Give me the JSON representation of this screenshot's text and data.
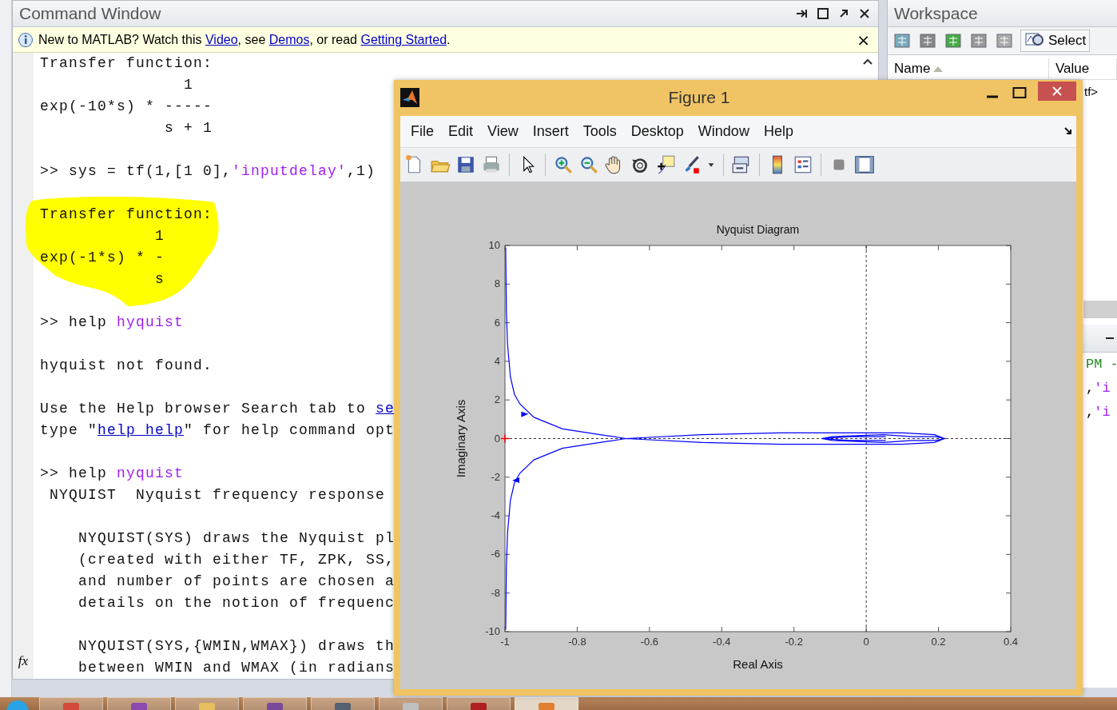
{
  "command_window": {
    "title": "Command Window",
    "banner": {
      "segments": [
        {
          "kind": "plain",
          "text": "New to MATLAB? Watch this "
        },
        {
          "kind": "link",
          "text": "Video"
        },
        {
          "kind": "plain",
          "text": ", see "
        },
        {
          "kind": "link",
          "text": "Demos"
        },
        {
          "kind": "plain",
          "text": ", or read "
        },
        {
          "kind": "link",
          "text": "Getting Started"
        },
        {
          "kind": "plain",
          "text": "."
        }
      ],
      "close": "×"
    },
    "lines": [
      {
        "kind": "text",
        "highlighted": false,
        "segments": [
          {
            "kind": "plain",
            "text": "Transfer function:"
          }
        ]
      },
      {
        "kind": "text",
        "highlighted": false,
        "segments": [
          {
            "kind": "plain",
            "text": "               1"
          }
        ]
      },
      {
        "kind": "text",
        "highlighted": false,
        "segments": [
          {
            "kind": "plain",
            "text": "exp(-10*s) * -----"
          }
        ]
      },
      {
        "kind": "text",
        "highlighted": false,
        "segments": [
          {
            "kind": "plain",
            "text": "             s + 1"
          }
        ]
      },
      {
        "kind": "blank"
      },
      {
        "kind": "text",
        "highlighted": false,
        "segments": [
          {
            "kind": "plain",
            "text": ">> sys = tf(1,[1 0],"
          },
          {
            "kind": "string",
            "text": "'inputdelay'"
          },
          {
            "kind": "plain",
            "text": ",1)"
          }
        ]
      },
      {
        "kind": "blank"
      },
      {
        "kind": "text",
        "highlighted": true,
        "segments": [
          {
            "kind": "plain",
            "text": "Transfer function:"
          }
        ]
      },
      {
        "kind": "text",
        "highlighted": true,
        "segments": [
          {
            "kind": "plain",
            "text": "            1"
          }
        ]
      },
      {
        "kind": "text",
        "highlighted": true,
        "segments": [
          {
            "kind": "plain",
            "text": "exp(-1*s) * -"
          }
        ]
      },
      {
        "kind": "text",
        "highlighted": true,
        "segments": [
          {
            "kind": "plain",
            "text": "            s"
          }
        ]
      },
      {
        "kind": "blank"
      },
      {
        "kind": "text",
        "highlighted": false,
        "segments": [
          {
            "kind": "plain",
            "text": ">> help "
          },
          {
            "kind": "string",
            "text": "hyquist"
          }
        ]
      },
      {
        "kind": "blank"
      },
      {
        "kind": "text",
        "highlighted": false,
        "segments": [
          {
            "kind": "plain",
            "text": "hyquist not found."
          }
        ]
      },
      {
        "kind": "blank"
      },
      {
        "kind": "text",
        "highlighted": false,
        "segments": [
          {
            "kind": "plain",
            "text": "Use the Help browser Search tab to "
          },
          {
            "kind": "link",
            "text": "se"
          }
        ]
      },
      {
        "kind": "text",
        "highlighted": false,
        "segments": [
          {
            "kind": "plain",
            "text": "type \""
          },
          {
            "kind": "link",
            "text": "help help"
          },
          {
            "kind": "plain",
            "text": "\" for help command opt"
          }
        ]
      },
      {
        "kind": "blank"
      },
      {
        "kind": "text",
        "highlighted": false,
        "segments": [
          {
            "kind": "plain",
            "text": ">> help "
          },
          {
            "kind": "string",
            "text": "nyquist"
          }
        ]
      },
      {
        "kind": "text",
        "highlighted": false,
        "segments": [
          {
            "kind": "plain",
            "text": " NYQUIST  Nyquist frequency response"
          }
        ]
      },
      {
        "kind": "blank"
      },
      {
        "kind": "text",
        "highlighted": false,
        "segments": [
          {
            "kind": "plain",
            "text": "    NYQUIST(SYS) draws the Nyquist pl"
          }
        ]
      },
      {
        "kind": "text",
        "highlighted": false,
        "segments": [
          {
            "kind": "plain",
            "text": "    (created with either TF, ZPK, SS,"
          }
        ]
      },
      {
        "kind": "text",
        "highlighted": false,
        "segments": [
          {
            "kind": "plain",
            "text": "    and number of points are chosen a"
          }
        ]
      },
      {
        "kind": "text",
        "highlighted": false,
        "segments": [
          {
            "kind": "plain",
            "text": "    details on the notion of frequenc"
          }
        ]
      },
      {
        "kind": "blank"
      },
      {
        "kind": "text",
        "highlighted": false,
        "segments": [
          {
            "kind": "plain",
            "text": "    NYQUIST(SYS,{WMIN,WMAX}) draws th"
          }
        ]
      },
      {
        "kind": "text",
        "highlighted": false,
        "segments": [
          {
            "kind": "plain",
            "text": "    between WMIN and WMAX (in radians"
          }
        ]
      }
    ],
    "prompt_icon": "fx"
  },
  "workspace": {
    "title": "Workspace",
    "select_button": "Select",
    "columns": [
      {
        "label": "Name",
        "sorted": true
      },
      {
        "label": "Value",
        "sorted": false
      }
    ],
    "rows": [
      {
        "value": "tf>"
      }
    ]
  },
  "history": {
    "lines": [
      {
        "segments": [
          {
            "kind": "comment",
            "text": "PM -"
          }
        ]
      },
      {
        "segments": [
          {
            "kind": "plain",
            "text": ","
          },
          {
            "kind": "string",
            "text": "'i"
          }
        ]
      },
      {
        "segments": [
          {
            "kind": "plain",
            "text": ","
          },
          {
            "kind": "string",
            "text": "'i"
          }
        ]
      }
    ]
  },
  "figure": {
    "title": "Figure 1",
    "menu": [
      "File",
      "Edit",
      "View",
      "Insert",
      "Tools",
      "Desktop",
      "Window",
      "Help"
    ],
    "chart_data": {
      "type": "line",
      "title": "Nyquist Diagram",
      "xlabel": "Real Axis",
      "ylabel": "Imaginary Axis",
      "xlim": [
        -1,
        0.4
      ],
      "ylim": [
        -10,
        10
      ],
      "xticks": [
        -1,
        -0.8,
        -0.6,
        -0.4,
        -0.2,
        0,
        0.2,
        0.4
      ],
      "yticks": [
        -10,
        -8,
        -6,
        -4,
        -2,
        0,
        2,
        4,
        6,
        8,
        10
      ],
      "x": [
        -0.998,
        -0.996,
        -0.993,
        -0.985,
        -0.974,
        -0.959,
        -0.92,
        -0.841,
        -0.665,
        -0.455,
        -0.239,
        -0.047,
        0.1,
        0.189,
        0.217,
        0.192,
        0.128,
        0.047,
        -0.094,
        -0.124,
        -0.046,
        0.054,
        null,
        -0.998,
        -0.996,
        -0.993,
        -0.985,
        -0.974,
        -0.959,
        -0.92,
        -0.841,
        -0.665,
        -0.455,
        -0.239,
        -0.047,
        0.1,
        0.189,
        0.217,
        0.192,
        0.128,
        0.047,
        -0.094,
        -0.124,
        -0.046,
        0.054
      ],
      "series": [
        {
          "color": "#0000ff",
          "values": [
            9.9,
            6.6,
            4.9,
            3.2,
            2.3,
            1.8,
            1.1,
            0.5,
            0.0,
            -0.2,
            -0.3,
            -0.3,
            -0.3,
            -0.2,
            0.0,
            0.1,
            0.1,
            0.2,
            0.1,
            0.0,
            -0.1,
            -0.1,
            null,
            -9.9,
            -6.6,
            -4.9,
            -3.2,
            -2.3,
            -1.8,
            -1.1,
            -0.5,
            0.0,
            0.2,
            0.3,
            0.3,
            0.3,
            0.2,
            0.0,
            -0.1,
            -0.1,
            -0.2,
            -0.1,
            0.0,
            0.1,
            0.1
          ]
        }
      ]
    }
  }
}
